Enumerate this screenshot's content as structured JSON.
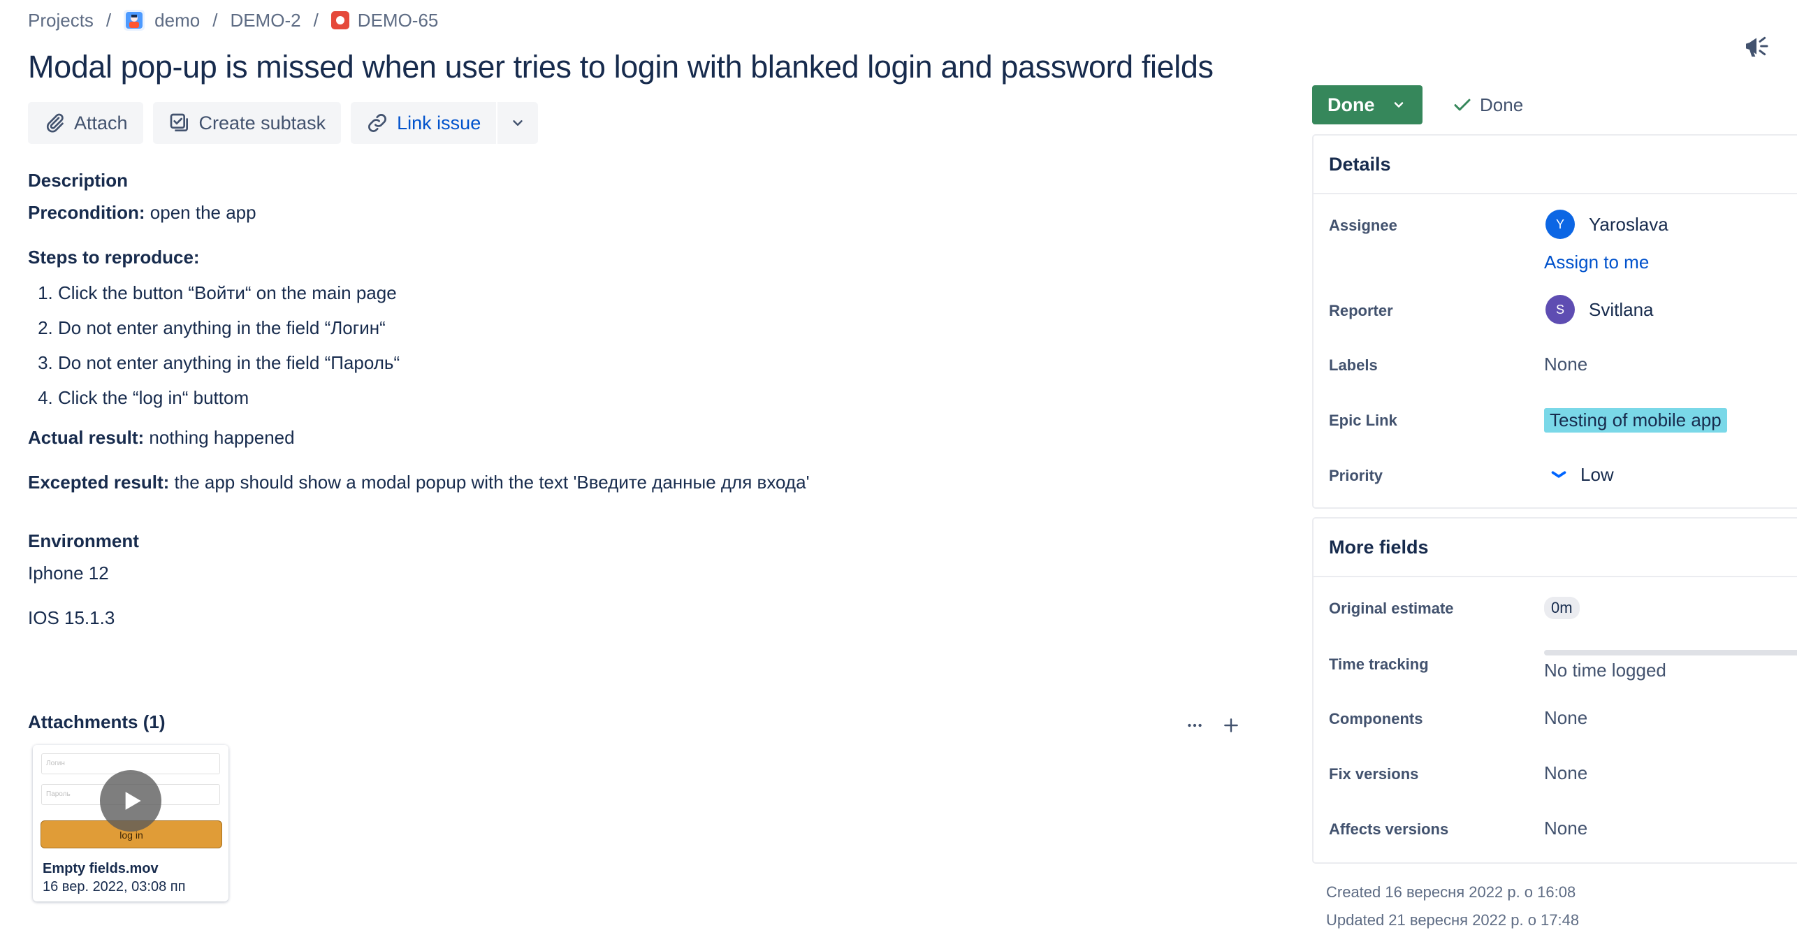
{
  "breadcrumb": {
    "projects": "Projects",
    "project": "demo",
    "parent": "DEMO-2",
    "issue": "DEMO-65",
    "separator": "/"
  },
  "issue": {
    "title": "Modal pop-up is missed when user tries to login with blanked login and password fields"
  },
  "toolbar": {
    "attach": "Attach",
    "create_subtask": "Create subtask",
    "link_issue": "Link issue"
  },
  "description": {
    "heading": "Description",
    "precondition_label": "Precondition:",
    "precondition_text": " open the app",
    "steps_heading": "Steps to reproduce:",
    "steps": [
      "Click the button “Войти“ on the main page",
      "Do not enter anything in the field “Логин“",
      "Do not enter anything in the field “Пароль“",
      "Click the “log in“ buttom"
    ],
    "actual_label": "Actual result:",
    "actual_text": " nothing happened",
    "expected_label": "Excepted result:",
    "expected_text": " the app should show a modal popup with the text 'Введите данные для входа'"
  },
  "environment": {
    "heading": "Environment",
    "device": "Iphone 12",
    "os": "IOS 15.1.3"
  },
  "attachments": {
    "heading": "Attachments (1)",
    "file": {
      "name": "Empty fields.mov",
      "date": "16 вер. 2022, 03:08 пп",
      "thumb_login": "Логин",
      "thumb_password": "Пароль",
      "thumb_button": "log in"
    }
  },
  "status": {
    "button": "Done",
    "resolution": "Done"
  },
  "details": {
    "heading": "Details",
    "assignee_label": "Assignee",
    "assignee_initial": "Y",
    "assignee_name": "Yaroslava",
    "assign_to_me": "Assign to me",
    "reporter_label": "Reporter",
    "reporter_initial": "S",
    "reporter_name": "Svitlana",
    "labels_label": "Labels",
    "labels_value": "None",
    "epic_label": "Epic Link",
    "epic_value": "Testing of mobile app",
    "priority_label": "Priority",
    "priority_value": "Low"
  },
  "more_fields": {
    "heading": "More fields",
    "original_estimate_label": "Original estimate",
    "original_estimate_value": "0m",
    "time_tracking_label": "Time tracking",
    "time_tracking_value": "No time logged",
    "components_label": "Components",
    "components_value": "None",
    "fix_versions_label": "Fix versions",
    "fix_versions_value": "None",
    "affects_versions_label": "Affects versions",
    "affects_versions_value": "None"
  },
  "meta": {
    "created": "Created 16 вересня 2022 р. о 16:08",
    "updated": "Updated 21 вересня 2022 р. о 17:48"
  },
  "colors": {
    "status_done": "#36875b",
    "epic": "#7ad8e8",
    "link": "#0052cc",
    "assignee_avatar": "#0c66e4",
    "reporter_avatar": "#5e4db2",
    "issue_type_bug": "#e5493a"
  },
  "icons": [
    "project-avatar-icon",
    "bug-icon",
    "paperclip-icon",
    "subtask-icon",
    "link-icon",
    "chevron-down-icon",
    "megaphone-icon",
    "check-icon",
    "priority-low-icon",
    "more-icon",
    "plus-icon",
    "play-icon"
  ]
}
